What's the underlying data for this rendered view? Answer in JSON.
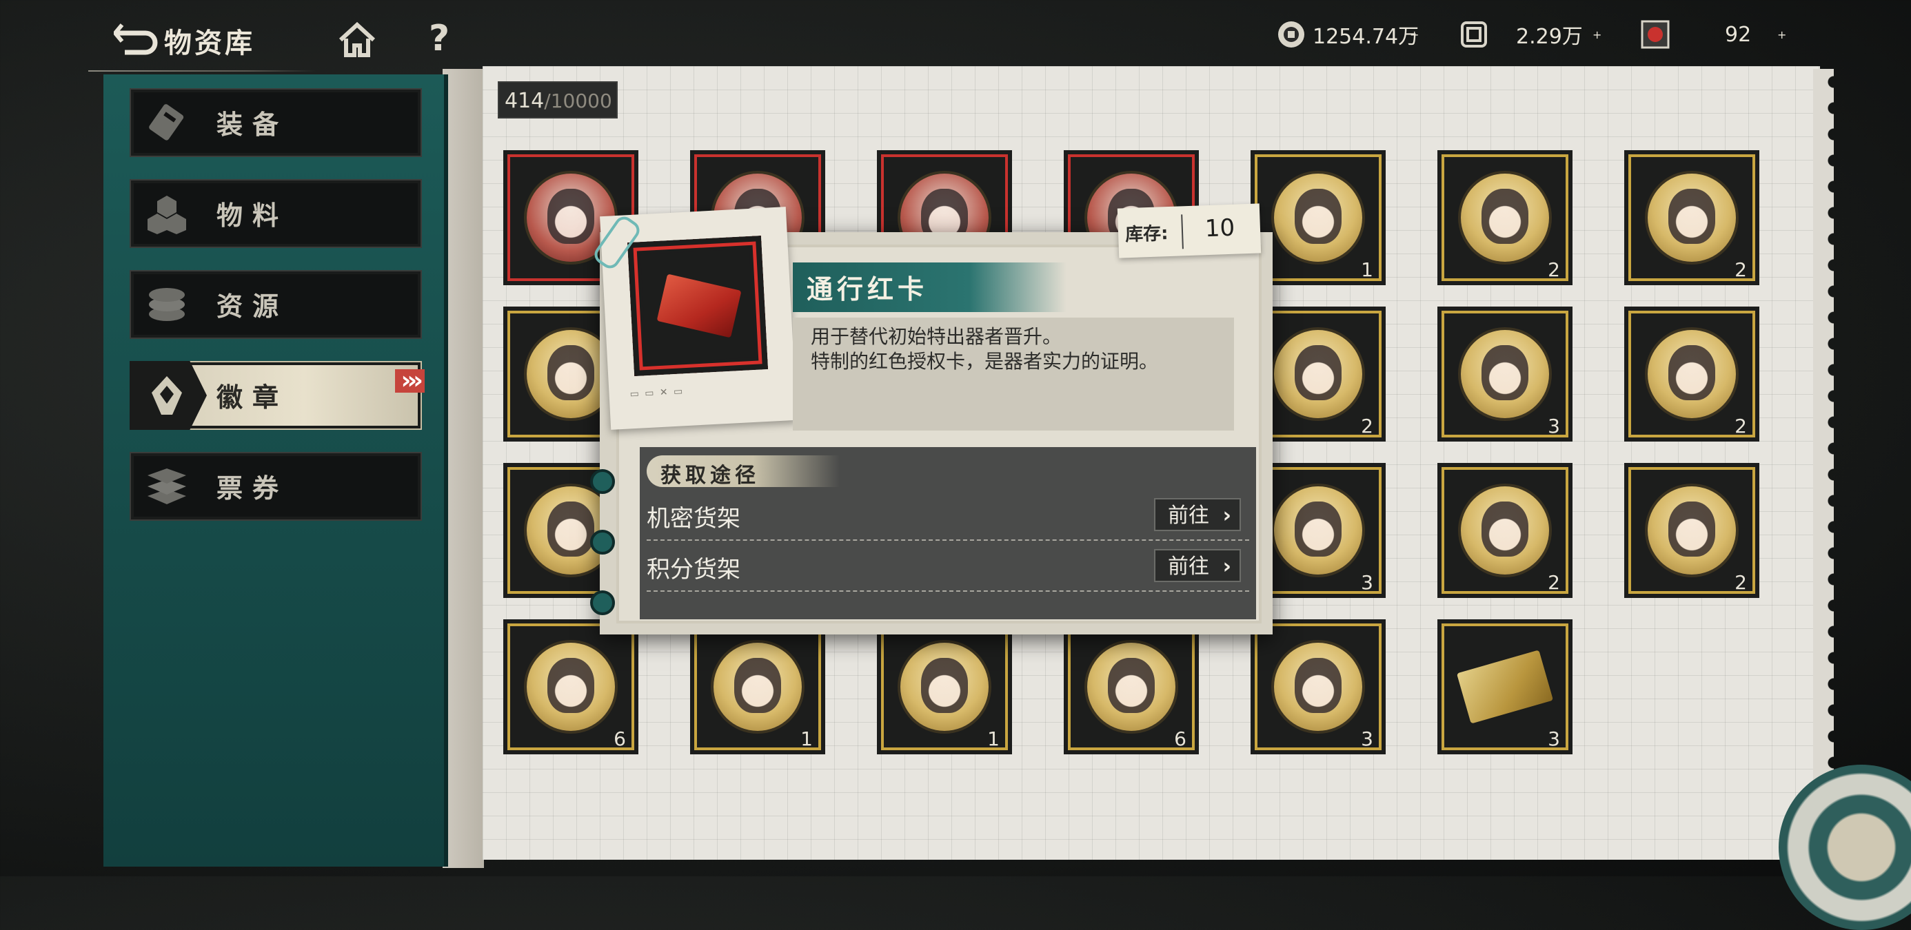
{
  "header": {
    "title": "物资库",
    "help_label": "?",
    "resources": [
      {
        "icon": "coin-icon",
        "value": "1254.74万",
        "plus": "+"
      },
      {
        "icon": "stamp-icon",
        "value": "2.29万",
        "plus": "+"
      },
      {
        "icon": "red-emblem-icon",
        "value": "92",
        "plus": "+"
      }
    ]
  },
  "sidebar": {
    "items": [
      {
        "label": "装备",
        "icon": "equipment-icon",
        "active": false
      },
      {
        "label": "物料",
        "icon": "materials-icon",
        "active": false
      },
      {
        "label": "资源",
        "icon": "resources-icon",
        "active": false
      },
      {
        "label": "徽章",
        "icon": "badge-icon",
        "active": true
      },
      {
        "label": "票券",
        "icon": "tickets-icon",
        "active": false
      }
    ],
    "active_chevron": "›››"
  },
  "inventory": {
    "count": "414",
    "capacity": "/10000",
    "items": [
      {
        "frame": "red",
        "qty": ""
      },
      {
        "frame": "red",
        "qty": ""
      },
      {
        "frame": "red",
        "qty": ""
      },
      {
        "frame": "red",
        "qty": ""
      },
      {
        "frame": "gold",
        "qty": "1"
      },
      {
        "frame": "gold",
        "qty": "2"
      },
      {
        "frame": "gold",
        "qty": "2"
      },
      {
        "frame": "gold",
        "qty": ""
      },
      {
        "frame": "gold",
        "qty": ""
      },
      {
        "frame": "gold",
        "qty": ""
      },
      {
        "frame": "gold",
        "qty": ""
      },
      {
        "frame": "gold",
        "qty": "2"
      },
      {
        "frame": "gold",
        "qty": "3"
      },
      {
        "frame": "gold",
        "qty": "2"
      },
      {
        "frame": "gold",
        "qty": ""
      },
      {
        "frame": "gold",
        "qty": ""
      },
      {
        "frame": "gold",
        "qty": ""
      },
      {
        "frame": "gold",
        "qty": ""
      },
      {
        "frame": "gold",
        "qty": "3"
      },
      {
        "frame": "gold",
        "qty": "2"
      },
      {
        "frame": "gold",
        "qty": "2"
      },
      {
        "frame": "gold",
        "qty": "6"
      },
      {
        "frame": "gold",
        "qty": "1"
      },
      {
        "frame": "gold",
        "qty": "1"
      },
      {
        "frame": "gold",
        "qty": "6"
      },
      {
        "frame": "gold",
        "qty": "3"
      },
      {
        "frame": "gold",
        "qty": "3",
        "card": true
      }
    ]
  },
  "popup": {
    "name": "通行红卡",
    "stock_label": "库存:",
    "stock_value": "10",
    "desc_line1": "用于替代初始特出器者晋升。",
    "desc_line2": "特制的红色授权卡，是器者实力的证明。",
    "acquire_title": "获取途径",
    "sources": [
      {
        "label": "机密货架",
        "button": "前往"
      },
      {
        "label": "积分货架",
        "button": "前往"
      }
    ]
  },
  "colors": {
    "teal": "#1f5f5b",
    "gold_frame": "#c9a640",
    "red_frame": "#c9322e"
  }
}
